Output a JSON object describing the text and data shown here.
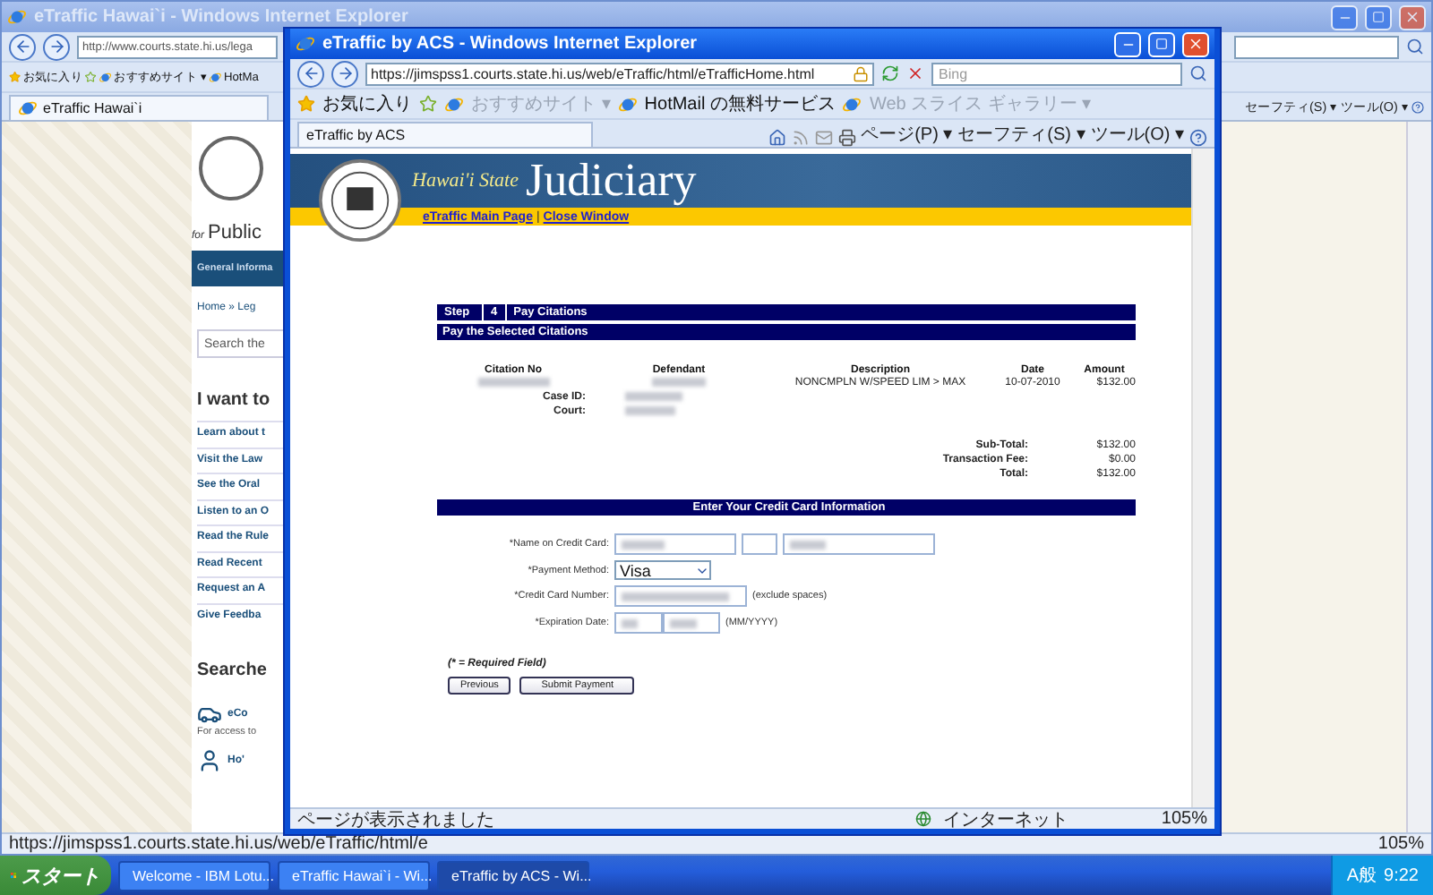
{
  "back_window": {
    "title": "eTraffic Hawai`i - Windows Internet Explorer",
    "address": "http://www.courts.state.hi.us/lega",
    "favorites": [
      "お気に入り",
      "おすすめサイト ▾",
      "HotMa"
    ],
    "tab": "eTraffic Hawai`i",
    "commands": [
      "セーフティ(S) ▾",
      "ツール(O) ▾"
    ],
    "page": {
      "tagline_prefix": "for",
      "tagline": "Public",
      "nav": "General Informa",
      "breadcrumb": "Home » Leg",
      "search_placeholder": "Search the",
      "heading": "I want to",
      "links": [
        "Learn about t",
        "Visit the Law",
        "See the Oral",
        "Listen to an O",
        "Read the Rule",
        "Read Recent",
        "Request an A",
        "Give Feedba"
      ],
      "section": "Searche",
      "services": [
        {
          "kind": "car",
          "title": "eCo",
          "text": "For access to"
        },
        {
          "kind": "person",
          "title": "Ho'"
        }
      ]
    },
    "status": "https://jimspss1.courts.state.hi.us/web/eTraffic/html/e",
    "zoom": "105%"
  },
  "front_window": {
    "title": "eTraffic by ACS - Windows Internet Explorer",
    "address": "https://jimspss1.courts.state.hi.us/web/eTraffic/html/eTrafficHome.html",
    "search_placeholder": "Bing",
    "favorites": [
      {
        "label": "お気に入り",
        "disabled": false
      },
      {
        "label": "おすすめサイト ▾",
        "disabled": true
      },
      {
        "label": "HotMail の無料サービス",
        "disabled": false
      },
      {
        "label": "Web スライス ギャラリー ▾",
        "disabled": true
      }
    ],
    "tab": "eTraffic by ACS",
    "commands": [
      "ページ(P) ▾",
      "セーフティ(S) ▾",
      "ツール(O) ▾"
    ],
    "page": {
      "site_prefix": "Hawai'i State",
      "site_name": "Judiciary",
      "links": [
        "eTraffic Main Page",
        "Close Window"
      ],
      "link_separator": "|",
      "step": {
        "label": "Step",
        "number": "4",
        "title": "Pay Citations"
      },
      "section": "Pay the Selected Citations",
      "columns": [
        "Citation No",
        "Defendant",
        "Description",
        "Date",
        "Amount"
      ],
      "citation": {
        "description": "NONCMPLN W/SPEED LIM > MAX",
        "date": "10-07-2010",
        "amount": "$132.00",
        "case_label": "Case ID:",
        "court_label": "Court:"
      },
      "totals": [
        {
          "label": "Sub-Total:",
          "value": "$132.00"
        },
        {
          "label": "Transaction Fee:",
          "value": "$0.00"
        },
        {
          "label": "Total:",
          "value": "$132.00"
        }
      ],
      "card_heading": "Enter Your Credit Card Information",
      "form": {
        "name_label": "*Name on Credit Card:",
        "method_label": "*Payment Method:",
        "method_value": "Visa",
        "number_label": "*Credit Card Number:",
        "number_hint": "(exclude spaces)",
        "expiry_label": "*Expiration Date:",
        "expiry_hint": "(MM/YYYY)"
      },
      "required_note": "(* = Required Field)",
      "buttons": [
        "Previous",
        "Submit Payment"
      ]
    },
    "status": "ページが表示されました",
    "zone": "インターネット",
    "zoom": "105%"
  },
  "taskbar": {
    "start": "スタート",
    "tasks": [
      {
        "label": "Welcome - IBM Lotu...",
        "selected": false
      },
      {
        "label": "eTraffic Hawai`i - Wi...",
        "selected": false
      },
      {
        "label": "eTraffic by ACS - Wi...",
        "selected": true
      }
    ],
    "ime": "A般",
    "clock": "9:22"
  }
}
